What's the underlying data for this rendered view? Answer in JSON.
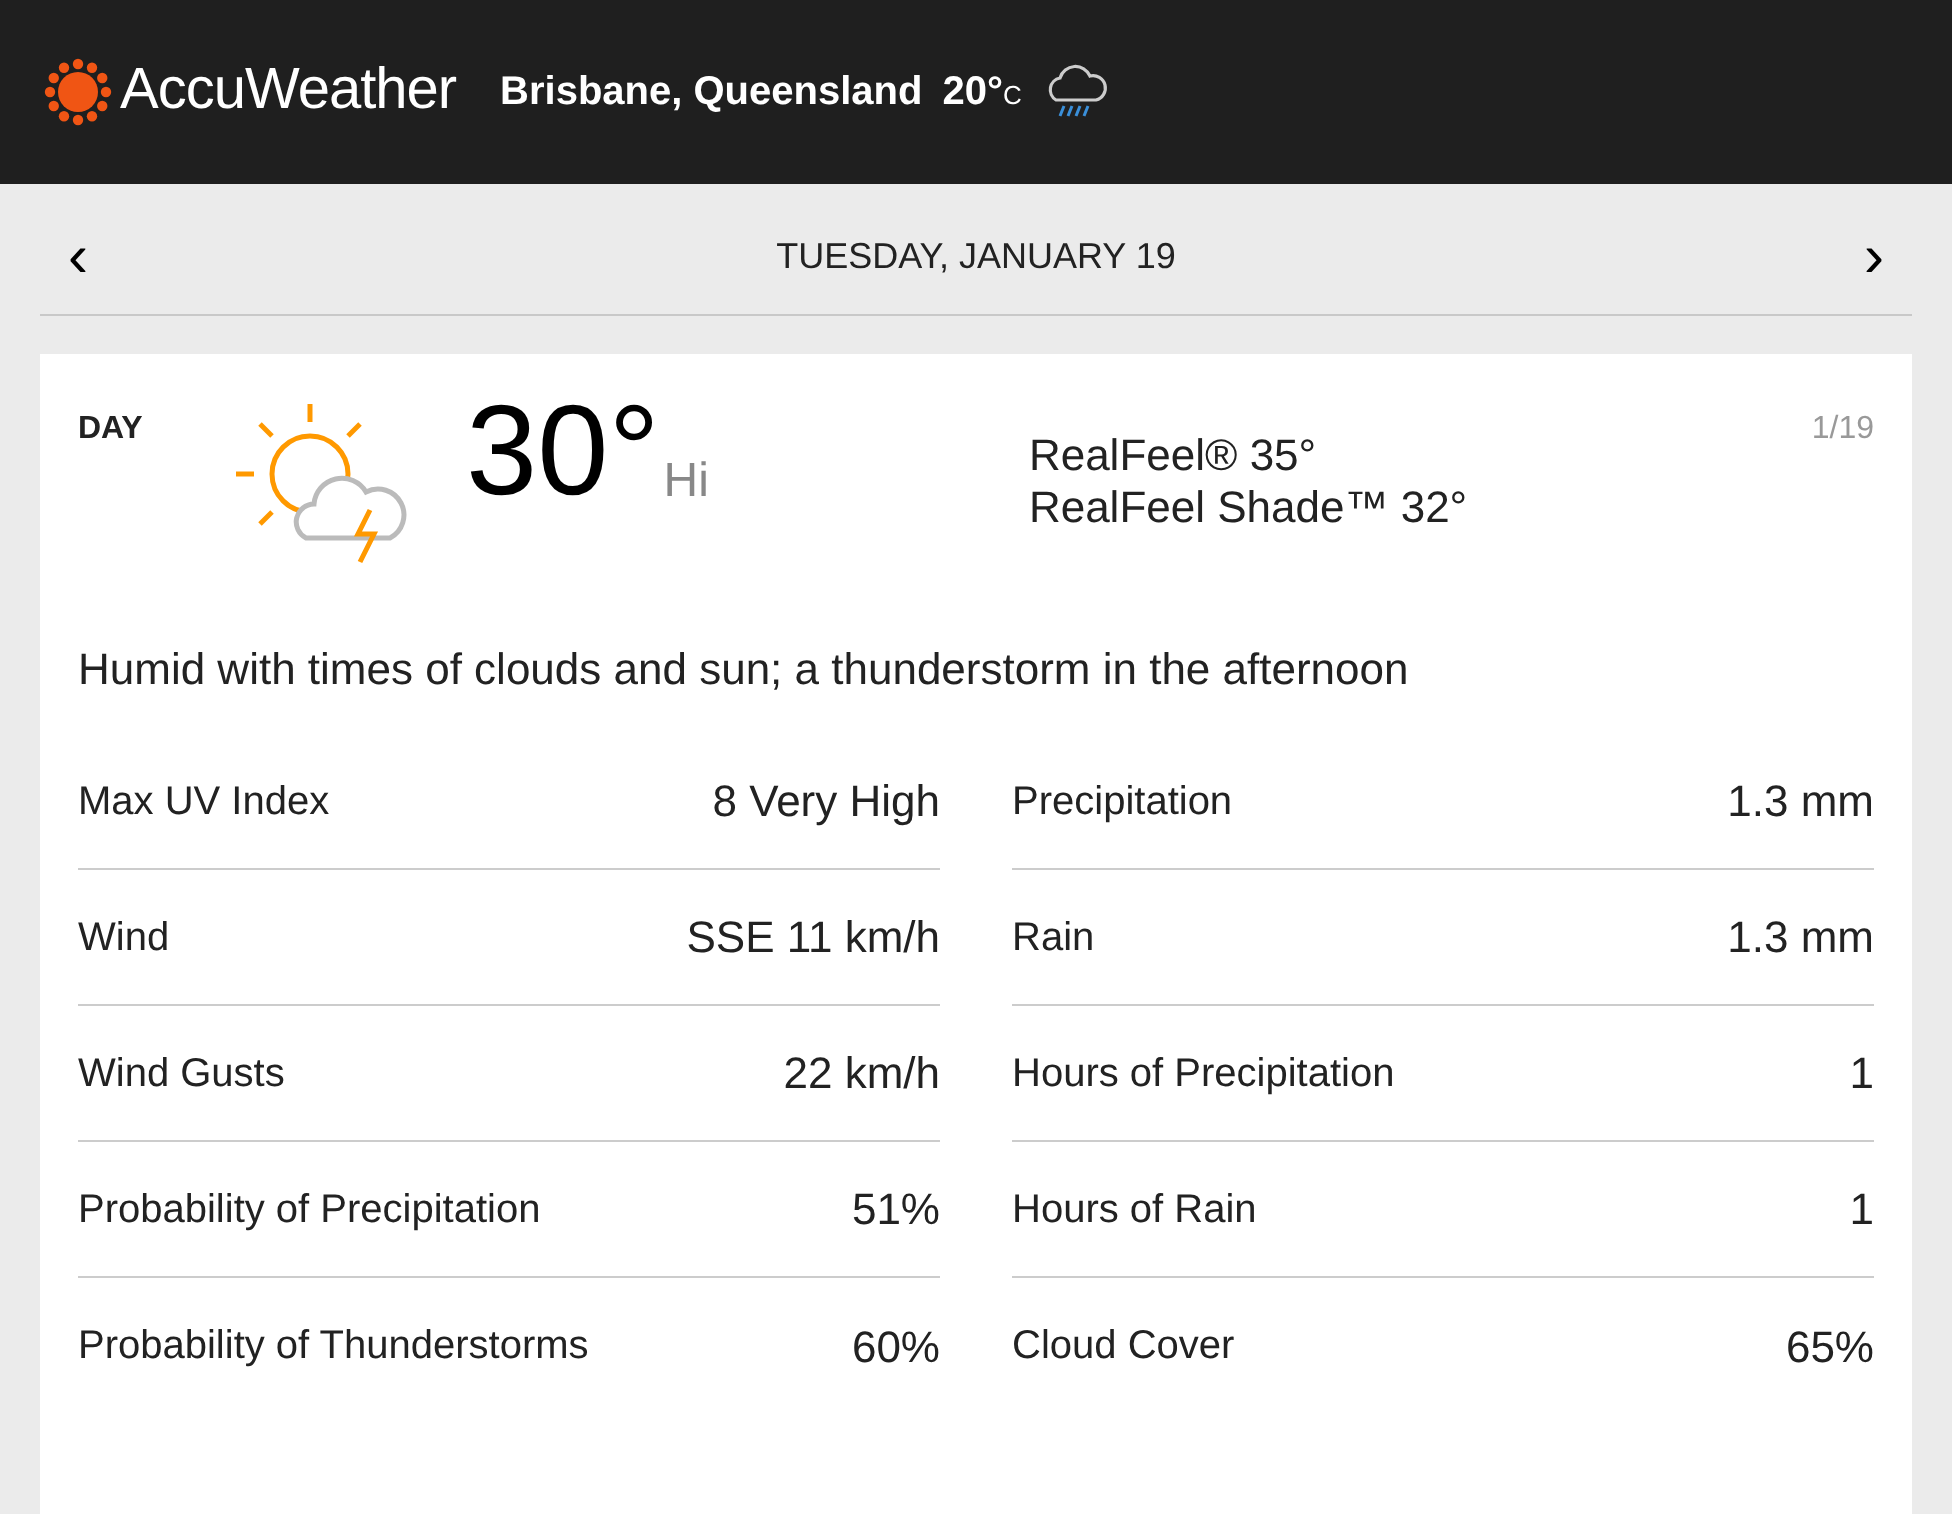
{
  "header": {
    "brand": "AccuWeather",
    "location": "Brisbane, Queensland",
    "temp": "20°",
    "unit": "C"
  },
  "date_nav": {
    "prev": "‹",
    "label": "TUESDAY, JANUARY 19",
    "next": "›"
  },
  "card": {
    "period": "DAY",
    "temp": "30°",
    "temp_label": "Hi",
    "realfeel": "RealFeel® 35°",
    "realfeel_shade": "RealFeel Shade™ 32°",
    "date": "1/19",
    "phrase": "Humid with times of clouds and sun; a thunderstorm in the afternoon",
    "left": [
      {
        "label": "Max UV Index",
        "value": "8 Very High"
      },
      {
        "label": "Wind",
        "value": "SSE 11 km/h"
      },
      {
        "label": "Wind Gusts",
        "value": "22 km/h"
      },
      {
        "label": "Probability of Precipitation",
        "value": "51%"
      },
      {
        "label": "Probability of Thunderstorms",
        "value": "60%"
      }
    ],
    "right": [
      {
        "label": "Precipitation",
        "value": "1.3 mm"
      },
      {
        "label": "Rain",
        "value": "1.3 mm"
      },
      {
        "label": "Hours of Precipitation",
        "value": "1"
      },
      {
        "label": "Hours of Rain",
        "value": "1"
      },
      {
        "label": "Cloud Cover",
        "value": "65%"
      }
    ]
  }
}
